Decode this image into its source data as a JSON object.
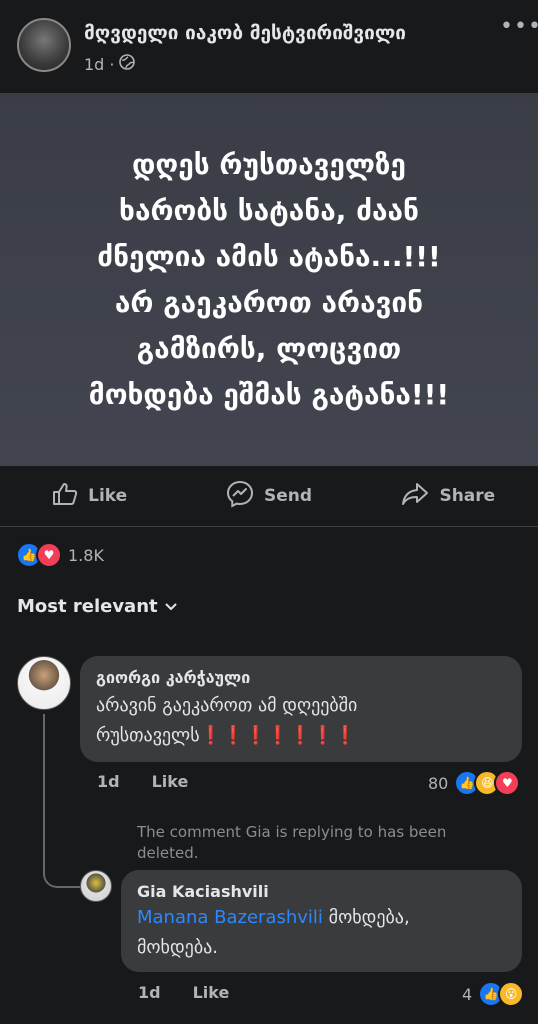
{
  "post": {
    "author": "მღვდელი იაკობ მესტვირიშვილი",
    "time": "1d",
    "privacy_icon": "globe-icon",
    "more_icon": "more-dots-icon",
    "text_lines": [
      "დღეს რუსთაველზე",
      "ხარობს სატანა, ძაან",
      "ძნელია ამის ატანა...!!!",
      "არ გაეკაროთ არავინ",
      "გამზირს, ლოცვით",
      "მოხდება ეშმას გატანა!!!"
    ],
    "banner_color": "#3e414b"
  },
  "actions": {
    "like": "Like",
    "send": "Send",
    "share": "Share"
  },
  "reactions": {
    "types": [
      "like",
      "love"
    ],
    "count": "1.8K"
  },
  "sort": {
    "label": "Most relevant"
  },
  "comments": [
    {
      "author": "გიორგი კარჭაული",
      "text_line1": "არავინ გაეკაროთ ამ დღეებში",
      "text_line2": "რუსთაველს",
      "text_marks": "❗❗❗❗❗❗❗",
      "time": "1d",
      "like_label": "Like",
      "reaction_types": [
        "like",
        "haha",
        "love"
      ],
      "reaction_count": "80"
    },
    {
      "deleted_notice": "The comment Gia is replying to has been deleted.",
      "author": "Gia Kaciashvili",
      "mention": "Manana Bazerashvili",
      "text_line1_rest": " მოხდება,",
      "text_line2": "მოხდება.",
      "time": "1d",
      "like_label": "Like",
      "reaction_types": [
        "like",
        "wow"
      ],
      "reaction_count": "4"
    }
  ],
  "colors": {
    "background": "#18191a",
    "bubble": "#3a3b3c",
    "like_blue": "#1877f2",
    "love_red": "#f33e58",
    "mention_blue": "#2d88ff"
  }
}
